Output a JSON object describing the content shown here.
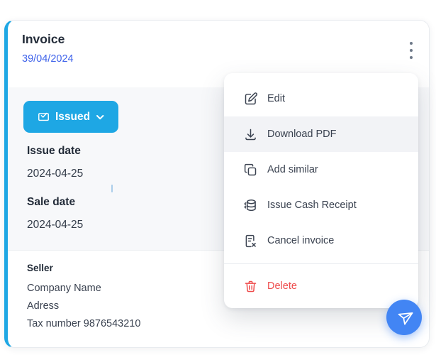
{
  "card": {
    "title": "Invoice",
    "invoice_number": "39/04/2024",
    "status_button": {
      "label": "Issued",
      "icon": "envelope-check-icon",
      "color": "#1ea7e4"
    },
    "fields": [
      {
        "label": "Issue date",
        "value": "2024-04-25"
      },
      {
        "label": "Sale date",
        "value": "2024-04-25"
      }
    ],
    "seller": {
      "label": "Seller",
      "lines": [
        "Company Name",
        "Adress",
        "Tax number 9876543210"
      ]
    }
  },
  "menu": {
    "items": [
      {
        "label": "Edit",
        "icon": "edit-icon",
        "highlighted": false
      },
      {
        "label": "Download PDF",
        "icon": "download-icon",
        "highlighted": true
      },
      {
        "label": "Add similar",
        "icon": "copy-icon",
        "highlighted": false
      },
      {
        "label": "Issue Cash Receipt",
        "icon": "cash-receipt-icon",
        "highlighted": false
      },
      {
        "label": "Cancel invoice",
        "icon": "file-x-icon",
        "highlighted": false
      }
    ],
    "delete_item": {
      "label": "Delete",
      "icon": "trash-icon",
      "color": "#ee4b4b"
    }
  },
  "fab": {
    "icon": "send-icon",
    "color": "#4285f4"
  },
  "colors": {
    "accent_blue": "#1ea7e4",
    "link_blue": "#3f63ea",
    "danger_red": "#ee4b4b",
    "fab_blue": "#4285f4",
    "section_gray": "#f7f8fa",
    "menu_highlight": "#f2f3f6",
    "text_dark": "#222b38",
    "text_body": "#3a4250"
  }
}
